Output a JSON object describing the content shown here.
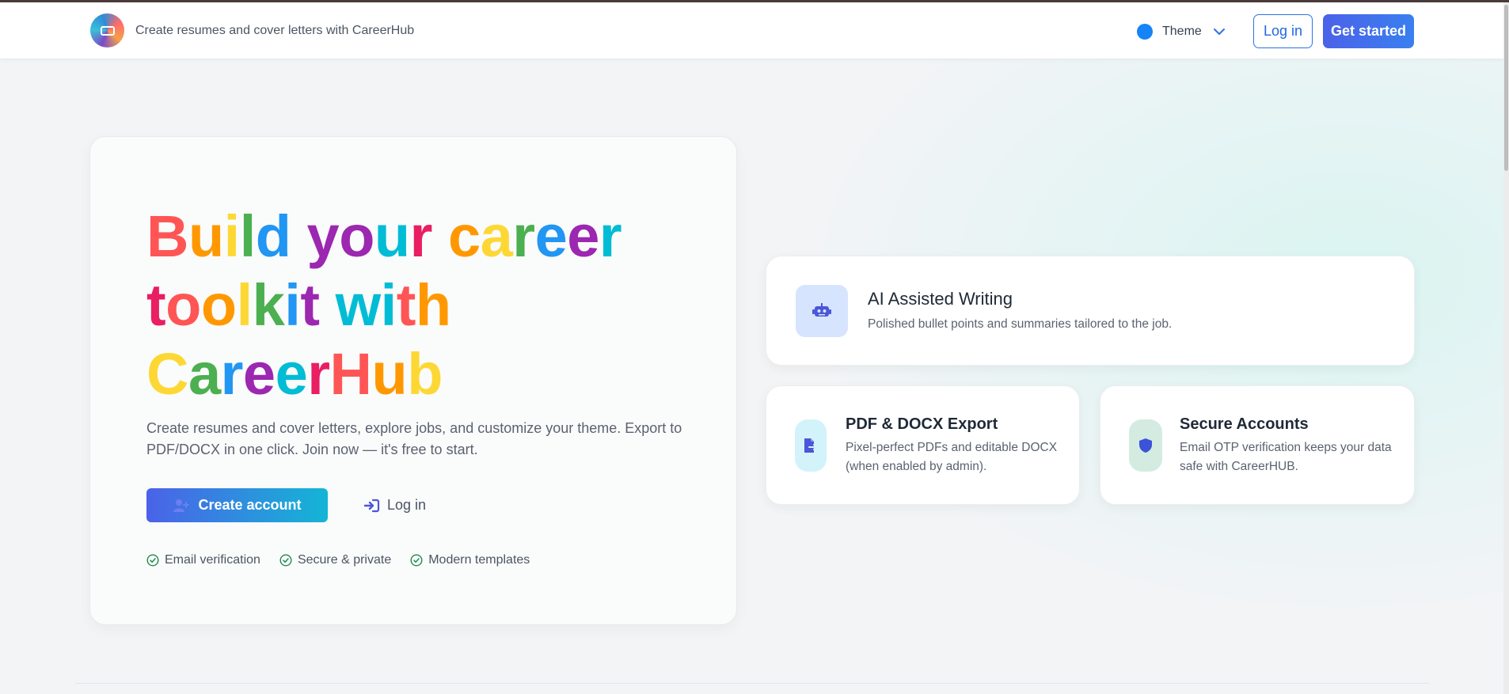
{
  "header": {
    "brand_text": "Create resumes and cover letters with CareerHub",
    "theme_label": "Theme",
    "login_label": "Log in",
    "get_started_label": "Get started"
  },
  "hero": {
    "headline_words": [
      [
        {
          "t": "B",
          "c": "#ff5555"
        },
        {
          "t": "u",
          "c": "#ff9800"
        },
        {
          "t": "i",
          "c": "#fdd835"
        },
        {
          "t": "l",
          "c": "#4caf50"
        },
        {
          "t": "d",
          "c": "#2196f3"
        }
      ],
      [
        {
          "t": "y",
          "c": "#9c27b0"
        },
        {
          "t": "o",
          "c": "#9c27b0"
        },
        {
          "t": "u",
          "c": "#00bcd4"
        },
        {
          "t": "r",
          "c": "#e91e63"
        }
      ],
      [
        {
          "t": "c",
          "c": "#ff9800"
        },
        {
          "t": "a",
          "c": "#fdd835"
        },
        {
          "t": "r",
          "c": "#4caf50"
        },
        {
          "t": "e",
          "c": "#2196f3"
        },
        {
          "t": "e",
          "c": "#9c27b0"
        },
        {
          "t": "r",
          "c": "#00bcd4"
        }
      ],
      [
        {
          "t": "t",
          "c": "#e91e63"
        },
        {
          "t": "o",
          "c": "#ff5555"
        },
        {
          "t": "o",
          "c": "#ff9800"
        },
        {
          "t": "l",
          "c": "#fdd835"
        },
        {
          "t": "k",
          "c": "#4caf50"
        },
        {
          "t": "i",
          "c": "#2196f3"
        },
        {
          "t": "t",
          "c": "#9c27b0"
        }
      ],
      [
        {
          "t": "w",
          "c": "#00bcd4"
        },
        {
          "t": "i",
          "c": "#00bcd4"
        },
        {
          "t": "t",
          "c": "#ff5555"
        },
        {
          "t": "h",
          "c": "#ff9800"
        }
      ],
      [
        {
          "t": "C",
          "c": "#fdd835"
        },
        {
          "t": "a",
          "c": "#4caf50"
        },
        {
          "t": "r",
          "c": "#2196f3"
        },
        {
          "t": "e",
          "c": "#9c27b0"
        },
        {
          "t": "e",
          "c": "#00bcd4"
        },
        {
          "t": "r",
          "c": "#e91e63"
        },
        {
          "t": "H",
          "c": "#ff5555"
        },
        {
          "t": "u",
          "c": "#ff9800"
        },
        {
          "t": "b",
          "c": "#fdd835"
        }
      ]
    ],
    "subtitle": "Create resumes and cover letters, explore jobs, and customize your theme. Export to PDF/DOCX in one click. Join now — it's free to start.",
    "create_account_label": "Create account",
    "login_label": "Log in",
    "checks": [
      "Email verification",
      "Secure & private",
      "Modern templates"
    ]
  },
  "features": {
    "ai": {
      "title": "AI Assisted Writing",
      "desc": "Polished bullet points and summaries tailored to the job.",
      "icon": "robot-icon"
    },
    "pdf": {
      "title": "PDF & DOCX Export",
      "desc": "Pixel-perfect PDFs and editable DOCX (when enabled by admin).",
      "icon": "file-export-icon"
    },
    "secure": {
      "title": "Secure Accounts",
      "desc": "Email OTP verification keeps your data safe with CareerHUB.",
      "icon": "shield-icon"
    }
  },
  "colors": {
    "accent": "#2b74e6",
    "theme_dot": "#1683f7",
    "check_green": "#1f8a4c"
  }
}
